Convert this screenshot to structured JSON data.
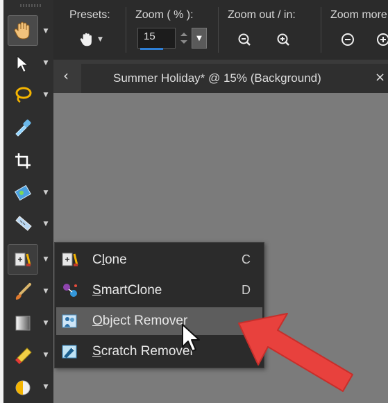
{
  "property_bar": {
    "presets_label": "Presets:",
    "zoom_label": "Zoom ( % ):",
    "zoom_value": "15",
    "zoom_out_in_label": "Zoom out / in:",
    "zoom_more_label": "Zoom more"
  },
  "document_tab": {
    "title": "Summer Holiday* @  15% (Background)",
    "close_glyph": "×",
    "back_glyph": "‹"
  },
  "flyout_menu": {
    "items": [
      {
        "label_pre": "C",
        "label_ul": "l",
        "label_post": "one",
        "shortcut": "C"
      },
      {
        "label_pre": "",
        "label_ul": "S",
        "label_post": "martClone",
        "shortcut": "D"
      },
      {
        "label_pre": "",
        "label_ul": "O",
        "label_post": "bject Remover",
        "shortcut": ""
      },
      {
        "label_pre": "",
        "label_ul": "S",
        "label_post": "cratch Remover",
        "shortcut": ""
      }
    ],
    "highlighted_index": 2
  },
  "colors": {
    "accent": "#2e7fd6",
    "arrow": "#e8413d",
    "canvas": "#7b7b7b",
    "toolbox": "#2e2e2e"
  },
  "icons": {
    "toolbox": [
      "pan-hand-icon",
      "pick-arrow-icon",
      "lasso-icon",
      "eyedropper-icon",
      "crop-icon",
      "image-adjust-icon",
      "straighten-icon",
      "clone-tool-icon",
      "paint-brush-icon",
      "fill-gradient-icon",
      "eraser-icon",
      "dodge-burn-icon"
    ]
  }
}
